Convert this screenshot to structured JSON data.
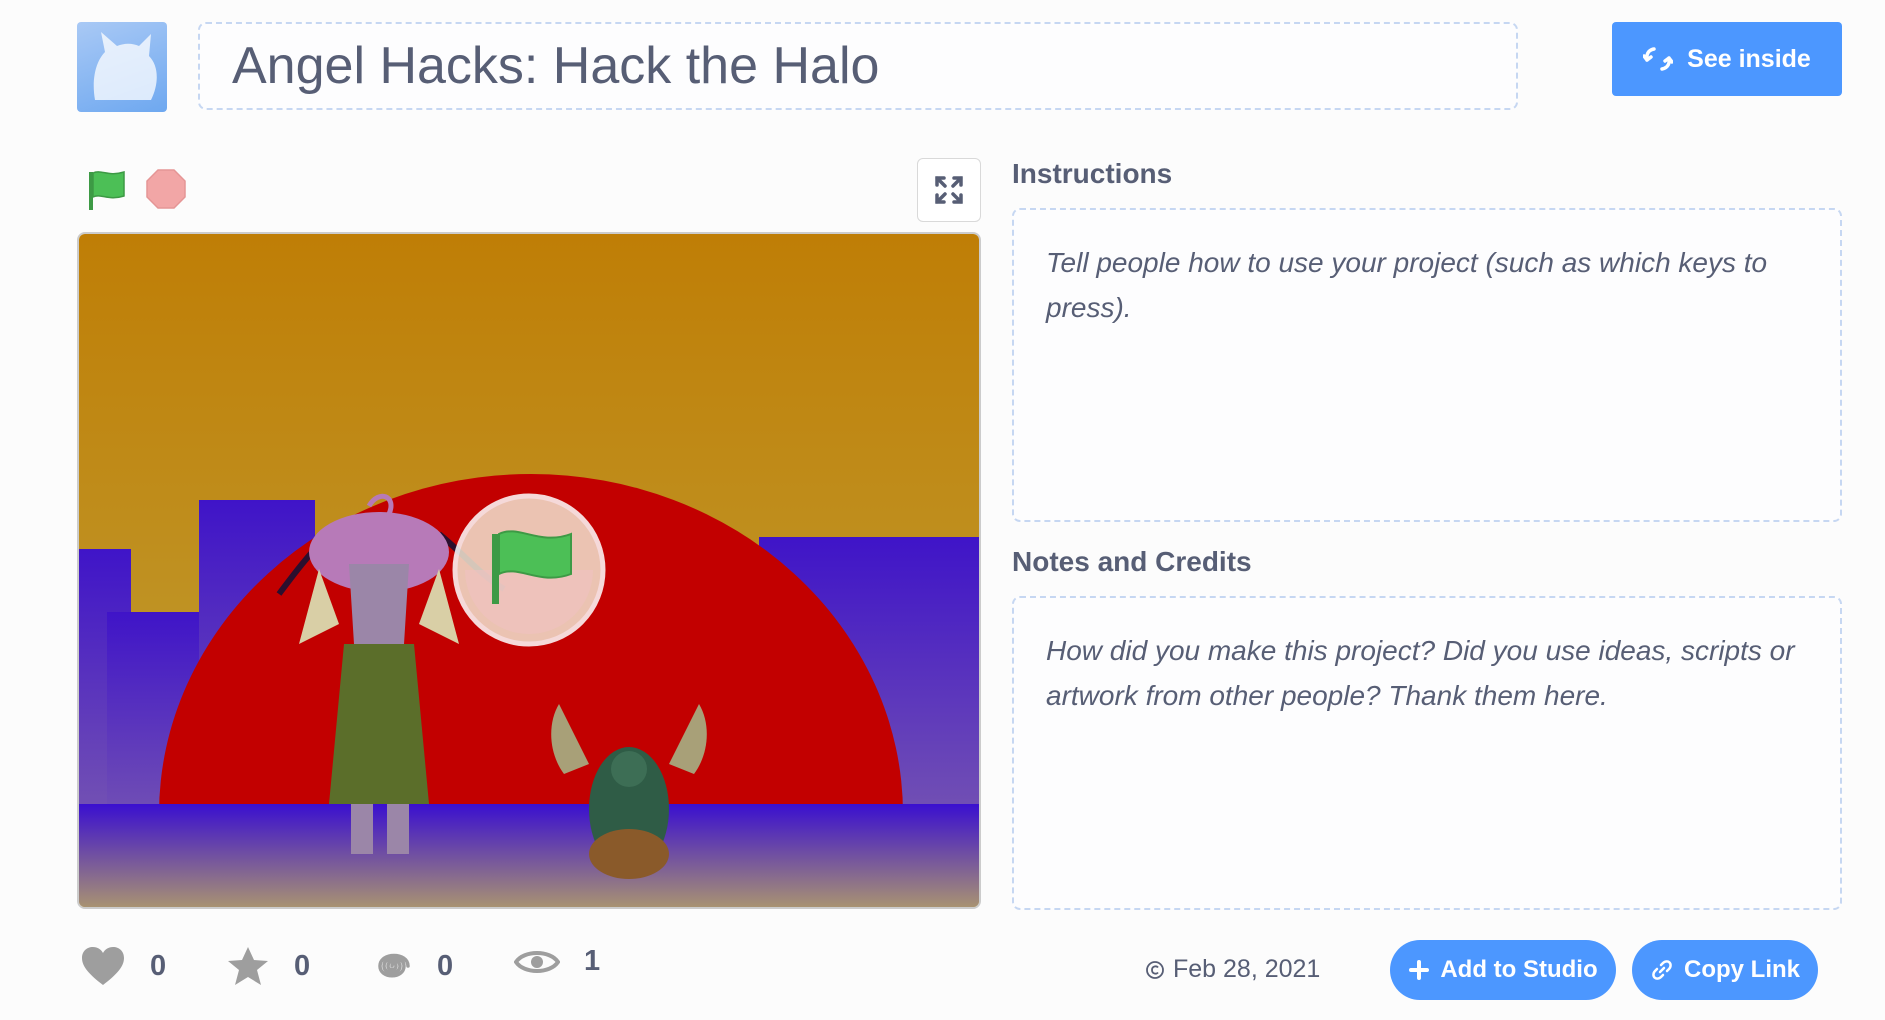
{
  "project": {
    "title": "Angel Hacks: Hack the Halo"
  },
  "header": {
    "see_inside_label": "See inside"
  },
  "instructions": {
    "heading": "Instructions",
    "placeholder": "Tell people how to use your project (such as which keys to press)."
  },
  "notes": {
    "heading": "Notes and Credits",
    "placeholder": "How did you make this project? Did you use ideas, scripts or artwork from other people? Thank them here."
  },
  "stats": {
    "loves": "0",
    "favorites": "0",
    "remixes": "0",
    "views": "1"
  },
  "meta": {
    "date": "Feb 28, 2021"
  },
  "actions": {
    "add_to_studio": "Add to Studio",
    "copy_link": "Copy Link"
  },
  "icons": {
    "see_inside": "remix-arrows-icon",
    "green_flag": "green-flag-icon",
    "stop": "stop-sign-icon",
    "fullscreen": "fullscreen-icon",
    "love": "heart-icon",
    "favorite": "star-icon",
    "remix": "spiral-icon",
    "views": "eye-icon",
    "date": "copyright-icon",
    "add": "plus-icon",
    "link": "link-icon"
  },
  "colors": {
    "accent": "#4c97ff",
    "flag_green": "#4cbf56",
    "stop_red": "#f2a6a6",
    "text": "#575e75"
  }
}
